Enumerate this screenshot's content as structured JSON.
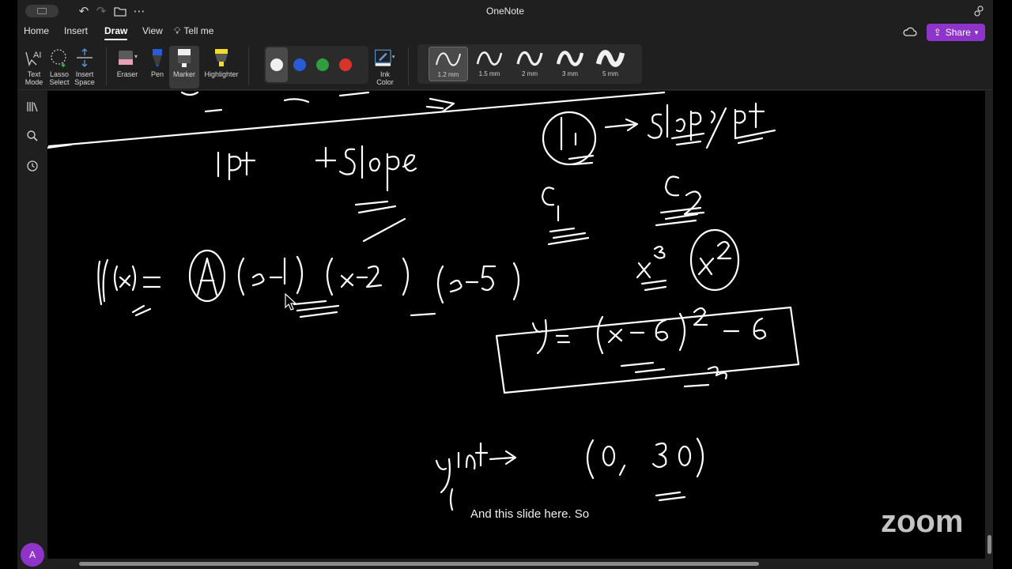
{
  "window": {
    "title": "OneNote"
  },
  "menu": {
    "tabs": [
      {
        "label": "Home"
      },
      {
        "label": "Insert"
      },
      {
        "label": "Draw"
      },
      {
        "label": "View"
      },
      {
        "label": "Tell me"
      }
    ],
    "active_tab": "Draw",
    "share_label": "Share"
  },
  "ribbon": {
    "text_mode": "Text Mode",
    "lasso_select": "Lasso Select",
    "insert_space": "Insert Space",
    "eraser": "Eraser",
    "pen": "Pen",
    "marker": "Marker",
    "highlighter": "Highlighter",
    "ink_color": "Ink Color",
    "colors": [
      "#f0f0f0",
      "#2a5bd7",
      "#2e9e3e",
      "#d9342b"
    ],
    "thickness": [
      {
        "label": "1.2 mm",
        "selected": true
      },
      {
        "label": "1.5 mm"
      },
      {
        "label": "2 mm"
      },
      {
        "label": "3 mm"
      },
      {
        "label": "5 mm"
      }
    ]
  },
  "user": {
    "avatar_initial": "A"
  },
  "canvas": {
    "caption": "And this slide here. So",
    "watermark": "zoom"
  },
  "colors": {
    "accent": "#8f34c9",
    "ink": "#ffffff",
    "background": "#000000"
  }
}
